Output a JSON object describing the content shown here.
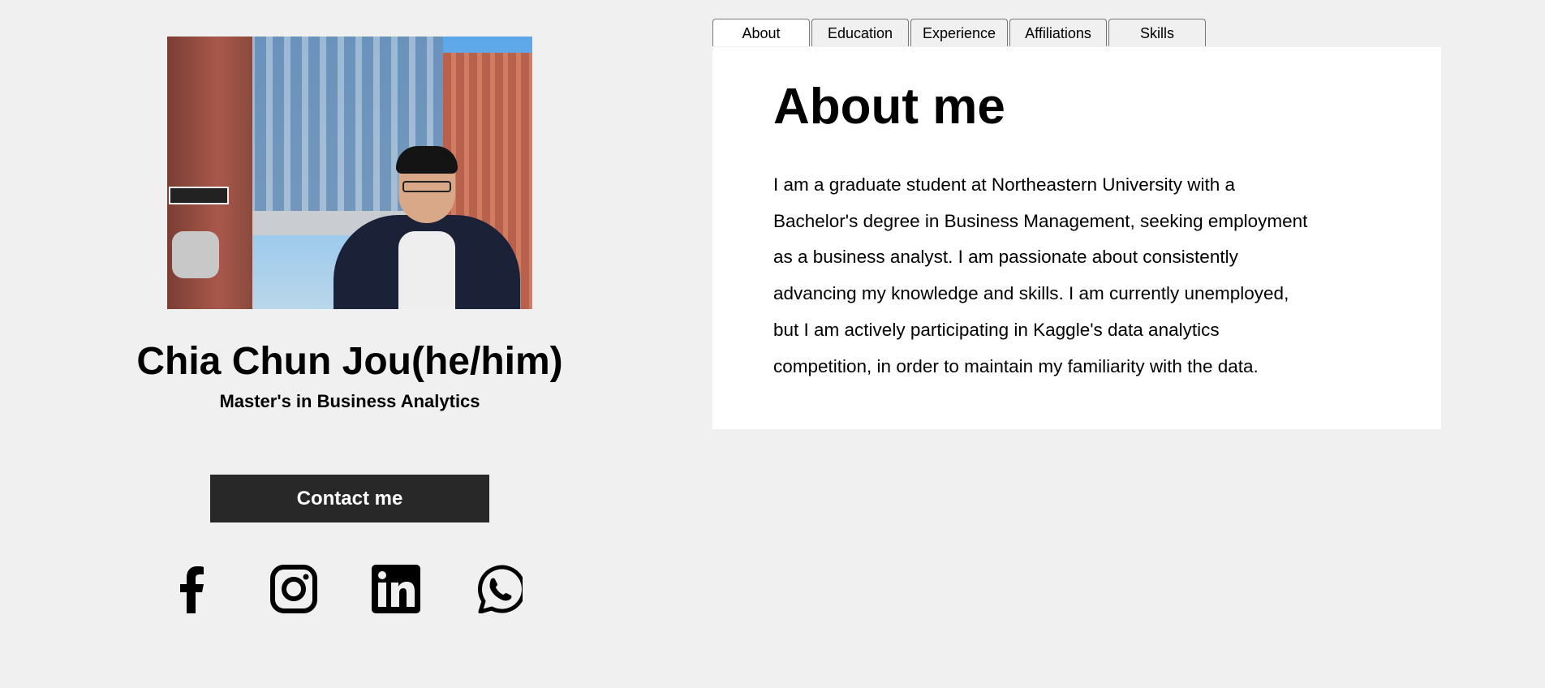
{
  "profile": {
    "name": "Chia Chun Jou(he/him)",
    "degree": "Master's in Business Analytics",
    "contact_label": "Contact me",
    "social": [
      "facebook-icon",
      "instagram-icon",
      "linkedin-icon",
      "whatsapp-icon"
    ]
  },
  "tabs": [
    {
      "label": "About",
      "active": true
    },
    {
      "label": "Education"
    },
    {
      "label": "Experience"
    },
    {
      "label": "Affiliations"
    },
    {
      "label": "Skills"
    }
  ],
  "about": {
    "heading": "About me",
    "lines": [
      "I am a graduate student at Northeastern University with a",
      "Bachelor's degree in Business Management, seeking employment",
      "as a business analyst. I am passionate about consistently",
      "advancing my knowledge and skills. I am currently unemployed,",
      "but I am actively participating in Kaggle's data analytics",
      "competition, in order to maintain my familiarity with the data."
    ]
  },
  "colors": {
    "background": "#f0f0f0",
    "button": "#282828",
    "panel": "#ffffff"
  }
}
